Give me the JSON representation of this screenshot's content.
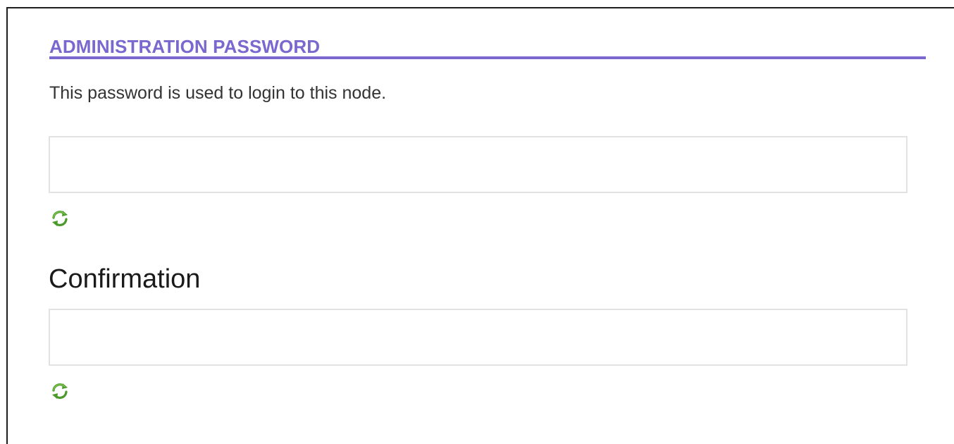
{
  "section": {
    "title": "ADMINISTRATION PASSWORD",
    "description": "This password is used to login to this node."
  },
  "password_field": {
    "value": "",
    "placeholder": "",
    "refresh_icon": "refresh-icon"
  },
  "confirmation_field": {
    "label": "Confirmation",
    "value": "",
    "placeholder": "",
    "refresh_icon": "refresh-icon"
  },
  "colors": {
    "accent": "#7b68cf",
    "icon_green": "#4a9a2a",
    "text": "#333333",
    "input_border": "#e2e2e2"
  }
}
